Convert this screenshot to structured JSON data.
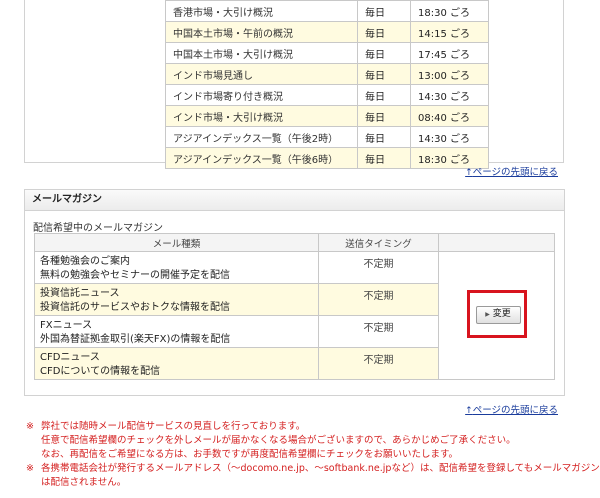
{
  "schedule": {
    "rows": [
      {
        "name": "香港市場・大引け概況",
        "freq": "毎日",
        "time": "18:30 ごろ"
      },
      {
        "name": "中国本土市場・午前の概況",
        "freq": "毎日",
        "time": "14:15 ごろ"
      },
      {
        "name": "中国本土市場・大引け概況",
        "freq": "毎日",
        "time": "17:45 ごろ"
      },
      {
        "name": "インド市場見通し",
        "freq": "毎日",
        "time": "13:00 ごろ"
      },
      {
        "name": "インド市場寄り付き概況",
        "freq": "毎日",
        "time": "14:30 ごろ"
      },
      {
        "name": "インド市場・大引け概況",
        "freq": "毎日",
        "time": "08:40 ごろ"
      },
      {
        "name": "アジアインデックス一覧（午後2時）",
        "freq": "毎日",
        "time": "14:30 ごろ"
      },
      {
        "name": "アジアインデックス一覧（午後6時）",
        "freq": "毎日",
        "time": "18:30 ごろ"
      }
    ]
  },
  "page_top_link": "ページの先頭に戻る",
  "page_top_arrow": "↑",
  "mail_magazine": {
    "section_title": "メールマガジン",
    "subtitle": "配信希望中のメールマガジン",
    "col_type": "メール種類",
    "col_timing": "送信タイミング",
    "items": [
      {
        "title": "各種勉強会のご案内",
        "desc": "無料の勉強会やセミナーの開催予定を配信",
        "timing": "不定期"
      },
      {
        "title": "投資信託ニュース",
        "desc": "投資信託のサービスやおトクな情報を配信",
        "timing": "不定期"
      },
      {
        "title": "FXニュース",
        "desc": "外国為替証拠金取引(楽天FX)の情報を配信",
        "timing": "不定期"
      },
      {
        "title": "CFDニュース",
        "desc": "CFDについての情報を配信",
        "timing": "不定期"
      }
    ],
    "change_button": "変更"
  },
  "notes": {
    "mark": "※",
    "line1": "弊社では随時メール配信サービスの見直しを行っております。",
    "line2": "任意で配信希望欄のチェックを外しメールが届かなくなる場合がございますので、あらかじめご了承ください。",
    "line3": "なお、再配信をご希望になる方は、お手数ですが再度配信希望欄にチェックをお願いいたします。",
    "line4": "各携帯電話会社が発行するメールアドレス（〜docomo.ne.jp、〜softbank.ne.jpなど）は、配信希望を登録してもメールマガジン",
    "line5": "は配信されません。"
  },
  "colors": {
    "accent_red": "#d8141e",
    "link_blue": "#1a3c9c",
    "row_highlight": "#fffbe0"
  }
}
